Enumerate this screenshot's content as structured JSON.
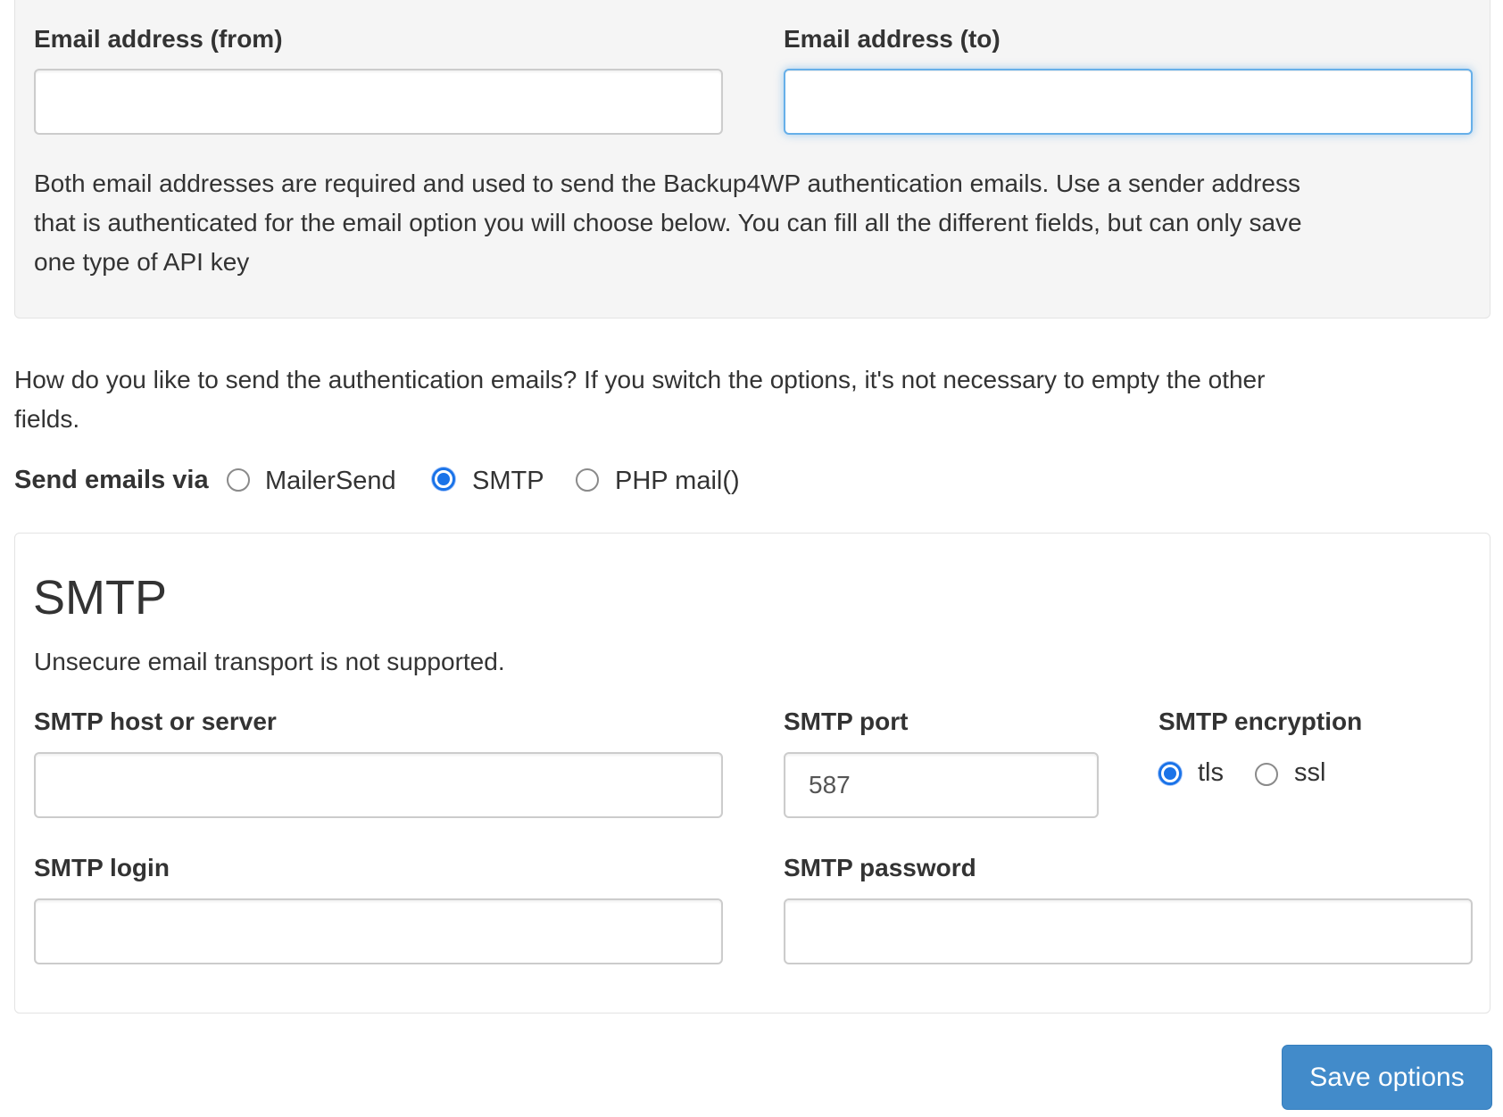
{
  "email_panel": {
    "from_label": "Email address (from)",
    "from_value": "",
    "to_label": "Email address (to)",
    "to_value": "",
    "help_lines": [
      "Both email addresses are required and used to send the Backup4WP authentication emails. Use a sender address",
      "that is authenticated for the email option you will choose below. You can fill all the different fields, but can only save",
      "one type of API key"
    ]
  },
  "question": {
    "lines": [
      "How do you like to send the authentication emails? If you switch the options, it's not necessary to empty the other",
      "fields."
    ]
  },
  "send_via": {
    "label": "Send emails via",
    "options": [
      {
        "label": "MailerSend",
        "checked": false
      },
      {
        "label": "SMTP",
        "checked": true
      },
      {
        "label": "PHP mail()",
        "checked": false
      }
    ]
  },
  "smtp": {
    "title": "SMTP",
    "notice": "Unsecure email transport is not supported.",
    "host_label": "SMTP host or server",
    "host_value": "",
    "port_label": "SMTP port",
    "port_value": "587",
    "encryption_label": "SMTP encryption",
    "encryption_options": [
      {
        "label": "tls",
        "checked": true
      },
      {
        "label": "ssl",
        "checked": false
      }
    ],
    "login_label": "SMTP login",
    "login_value": "",
    "password_label": "SMTP password",
    "password_value": ""
  },
  "actions": {
    "save_label": "Save options"
  },
  "colors": {
    "accent": "#1a73e8",
    "button": "#428bca",
    "panel_bg": "#f5f5f5",
    "focus_border": "#66afe9"
  }
}
